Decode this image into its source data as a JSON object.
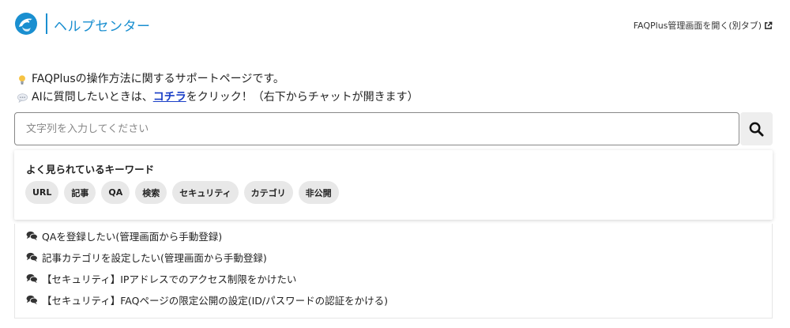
{
  "header": {
    "title": "ヘルプセンター",
    "admin_link": "FAQPlus管理画面を開く(別タブ)",
    "logo_icon": "dolphin-logo",
    "external_icon": "external-link-icon",
    "brand_color": "#1a8fd0"
  },
  "intro": {
    "line1": "FAQPlusの操作方法に関するサポートページです。",
    "line1_icon": "lightbulb-icon",
    "line2_before": "AIに質問したいときは、",
    "line2_link": "コチラ",
    "line2_after": "をクリック！（右下からチャットが開きます）",
    "line2_icon": "speech-bubble-icon",
    "link_color": "#1a3fc7"
  },
  "search": {
    "placeholder": "文字列を入力してください",
    "value": "",
    "button_icon": "search-icon"
  },
  "keywords": {
    "title": "よく見られているキーワード",
    "items": [
      "URL",
      "記事",
      "QA",
      "検索",
      "セキュリティ",
      "カテゴリ",
      "非公開"
    ]
  },
  "suggestions": {
    "icon": "comments-icon",
    "items": [
      "QAを登録したい(管理画面から手動登録)",
      "記事カテゴリを設定したい(管理画面から手動登録)",
      "【セキュリティ】IPアドレスでのアクセス制限をかけたい",
      "【セキュリティ】FAQページの限定公開の設定(ID/パスワードの認証をかける)"
    ]
  }
}
